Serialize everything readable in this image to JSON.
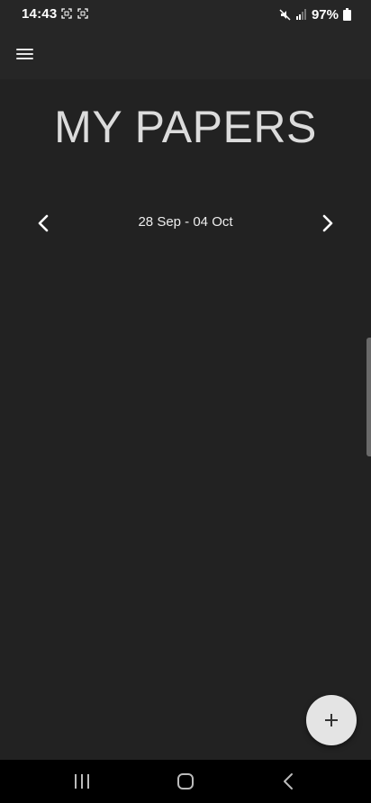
{
  "status_bar": {
    "time": "14:43",
    "battery": "97%",
    "icons": [
      "screenshot-icon",
      "screenshot-icon",
      "mute-icon",
      "signal-icon",
      "battery-icon"
    ]
  },
  "app_bar": {
    "menu_icon": "hamburger-menu-icon"
  },
  "main": {
    "title": "MY PAPERS",
    "date_range": "28 Sep - 04 Oct",
    "prev_icon": "chevron-left-icon",
    "next_icon": "chevron-right-icon"
  },
  "fab": {
    "icon": "plus-icon"
  },
  "system_nav": {
    "icons": [
      "recent-apps-icon",
      "home-icon",
      "back-icon"
    ]
  },
  "colors": {
    "background": "#222222",
    "app_bar": "#262626",
    "fab": "#e4e4e4",
    "nav_bar": "#000000"
  }
}
